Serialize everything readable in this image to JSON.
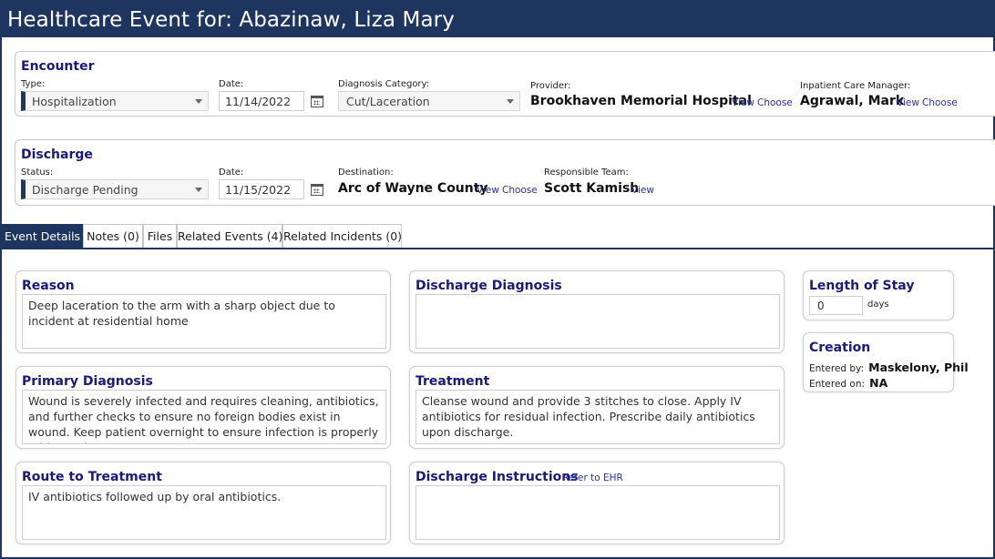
{
  "header": {
    "title": "Healthcare Event for: Abazinaw, Liza Mary"
  },
  "colors": {
    "brand": "#1e3560",
    "section_title": "#1a1a7a",
    "link": "#2d2ea8"
  },
  "encounter": {
    "title": "Encounter",
    "type_label": "Type:",
    "type_value": "Hospitalization",
    "date_label": "Date:",
    "date_value": "11/14/2022",
    "diagnosis_category_label": "Diagnosis Category:",
    "diagnosis_category_value": "Cut/Laceration",
    "provider_label": "Provider:",
    "provider_value": "Brookhaven Memorial Hospital",
    "provider_view": "View",
    "provider_choose": "Choose",
    "care_manager_label": "Inpatient Care Manager:",
    "care_manager_value": "Agrawal, Mark",
    "care_manager_view": "View",
    "care_manager_choose": "Choose"
  },
  "discharge": {
    "title": "Discharge",
    "status_label": "Status:",
    "status_value": "Discharge Pending",
    "date_label": "Date:",
    "date_value": "11/15/2022",
    "destination_label": "Destination:",
    "destination_value": "Arc of Wayne County",
    "destination_view": "View",
    "destination_choose": "Choose",
    "team_label": "Responsible Team:",
    "team_value": "Scott Kamish",
    "team_view": "View"
  },
  "tabs": [
    {
      "label": "Event Details",
      "active": true
    },
    {
      "label": "Notes (0)"
    },
    {
      "label": "Files"
    },
    {
      "label": "Related Events (4)"
    },
    {
      "label": "Related Incidents (0)"
    }
  ],
  "details": {
    "reason": {
      "title": "Reason",
      "text": "Deep laceration to the arm with a sharp object due to incident at residential home"
    },
    "primary_diagnosis": {
      "title": "Primary Diagnosis",
      "text": "Wound is severely infected and requires cleaning, antibiotics, and further checks to ensure no foreign bodies exist in wound. Keep patient overnight to ensure infection is properly addressed."
    },
    "route_to_treatment": {
      "title": "Route to Treatment",
      "text": "IV antibiotics followed up by oral antibiotics."
    },
    "discharge_diagnosis": {
      "title": "Discharge Diagnosis",
      "text": ""
    },
    "treatment": {
      "title": "Treatment",
      "text": "Cleanse wound and provide 3 stitches to close. Apply IV antibiotics for residual infection.  Prescribe daily antibiotics upon discharge."
    },
    "discharge_instructions": {
      "title": "Discharge Instructions",
      "link": "Refer to EHR",
      "text": ""
    }
  },
  "length_of_stay": {
    "title": "Length of Stay",
    "value": "0",
    "unit": "days"
  },
  "creation": {
    "title": "Creation",
    "entered_by_label": "Entered by:",
    "entered_by_value": "Maskelony, Phil",
    "entered_on_label": "Entered on:",
    "entered_on_value": "NA"
  }
}
